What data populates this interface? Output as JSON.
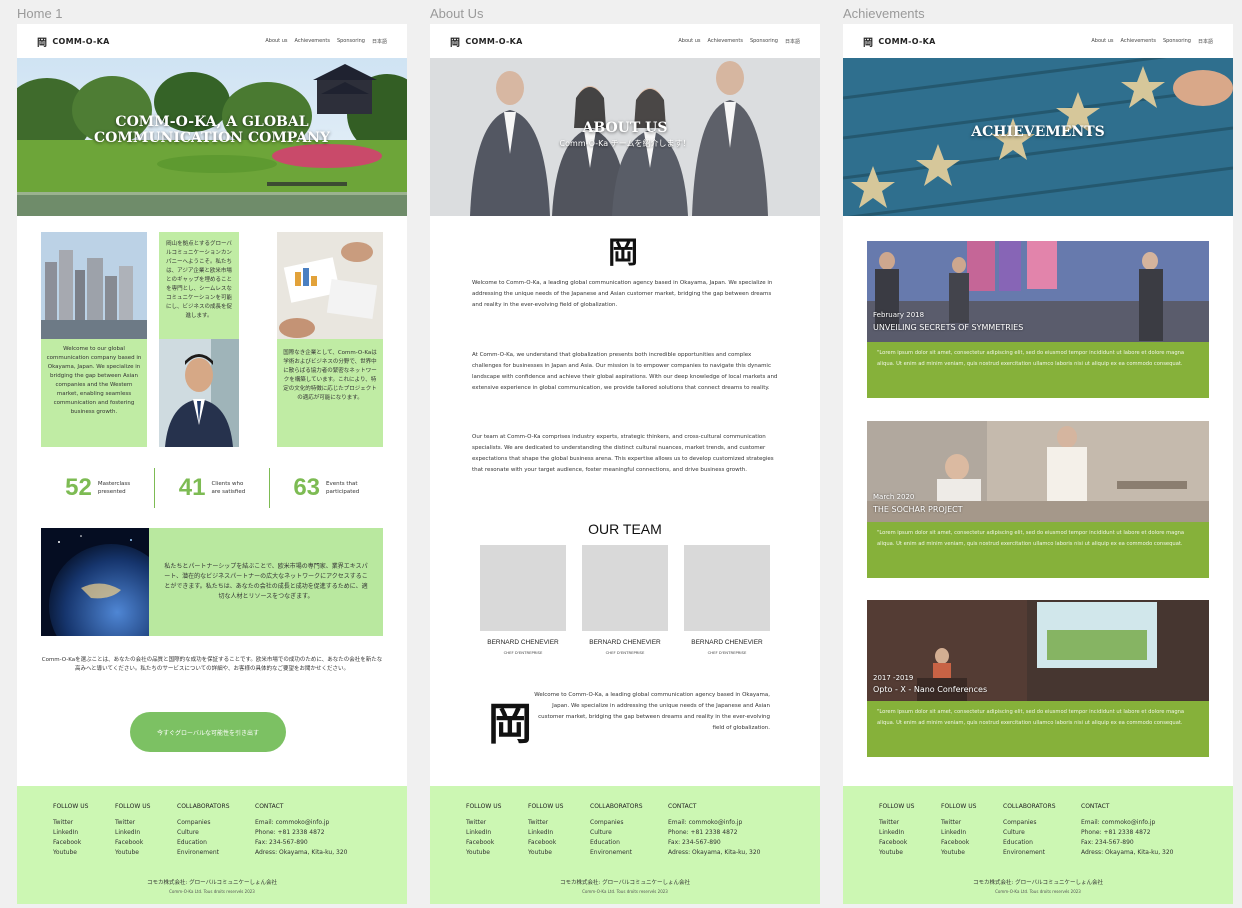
{
  "frames": [
    {
      "label": "Home 1"
    },
    {
      "label": "About Us"
    },
    {
      "label": "Achievements"
    }
  ],
  "header": {
    "logo_mark": "岡",
    "logo_text": "COMM-O-KA",
    "nav": [
      "About us",
      "Achievements",
      "Sponsoring",
      "日本語"
    ]
  },
  "home": {
    "hero_title_line1": "COMM-O-KA, A GLOBAL",
    "hero_title_line2": "COMMUNICATION COMPANY",
    "grid_text_jp1": "岡山を拠点とするグローバルコミュニケーションカンパニーへようこそ。私たちは、アジア企業と欧米市場とのギャップを埋めることを専門とし、シームレスなコミュニケーションを可能にし、ビジネスの成長を促進します。",
    "grid_text_en": "Welcome to our global communication company based in Okayama, Japan. We specialize in bridging the gap between Asian companies and the Western market, enabling seamless communication and fostering business growth.",
    "grid_text_jp2": "国際なき企業として、Comm-O-Kaは学術およびビジネスの分野で、世界中に散らばる協力者の緊密なネットワークを構築しています。これにより、特定の文化的特徴に応じたプロジェクトの適応が可能になります。",
    "stats": [
      {
        "num": "52",
        "label1": "Masterclass",
        "label2": "presented"
      },
      {
        "num": "41",
        "label1": "Clients who",
        "label2": "are satisfied"
      },
      {
        "num": "63",
        "label1": "Events that",
        "label2": "participated"
      }
    ],
    "globe_text": "私たちとパートナーシップを結ぶことで、欧米市場の専門家、業界エキスパート、潜在的なビジネスパートナーの広大なネットワークにアクセスすることができます。私たちは、あなたの会社の成長と成功を促進するために、適切な人材とリソースをつなぎます。",
    "choose_text": "Comm-O-Kaを選ぶことは、あなたの会社の品質と国際的な成功を保証することです。欧米市場での成功のために、あなたの会社を新たな高みへと導いてください。私たちのサービスについての詳細や、お客様の具体的なご要望をお聞かせください。",
    "cta": "今すぐグローバルな可能性を引き出す"
  },
  "about": {
    "hero_title": "ABOUT US",
    "hero_sub": "Comm-O-Ka チームを紹介します！",
    "kanji": "岡",
    "p1": "Welcome to Comm-O-Ka, a leading global communication agency based in Okayama, Japan. We specialize in addressing the unique needs of the Japanese and Asian customer market, bridging the gap between dreams and reality in the ever-evolving field of globalization.",
    "p2": "At Comm-O-Ka, we understand that globalization presents both incredible opportunities and complex challenges for businesses in Japan and Asia. Our mission is to empower companies to navigate this dynamic landscape with confidence and achieve their global aspirations. With our deep knowledge of local markets and extensive experience in global communication, we provide tailored solutions that connect dreams to reality.",
    "p3": "Our team at Comm-O-Ka comprises industry experts, strategic thinkers, and cross-cultural communication specialists. We are dedicated to understanding the distinct cultural nuances, market trends, and customer expectations that shape the global business arena. This expertise allows us to develop customized strategies that resonate with your target audience, foster meaningful connections, and drive business growth.",
    "team_title": "OUR TEAM",
    "team": [
      {
        "name": "BERNARD CHENEVIER",
        "role": "CHEF D'ENTREPRISE"
      },
      {
        "name": "BERNARD CHENEVIER",
        "role": "CHEF D'ENTREPRISE"
      },
      {
        "name": "BERNARD CHENEVIER",
        "role": "CHEF D'ENTREPRISE"
      }
    ],
    "p4": "Welcome to Comm-O-Ka, a leading global communication agency based in Okayama, Japan. We specialize in addressing the unique needs of the Japanese and Asian customer market, bridging the gap between dreams and reality in the ever-evolving field of globalization."
  },
  "achievements": {
    "hero_title": "ACHIEVEMENTS",
    "items": [
      {
        "date": "February 2018",
        "title": "UNVEILING SECRETS OF SYMMETRIES",
        "body": "\"Lorem ipsum dolor sit amet, consectetur adipiscing elit, sed do eiusmod tempor incididunt ut labore et dolore magna aliqua. Ut enim ad minim veniam, quis nostrud exercitation ullamco laboris nisi ut aliquip ex ea commodo consequat."
      },
      {
        "date": "March 2020",
        "title": "THE SOCHAR PROJECT",
        "body": "\"Lorem ipsum dolor sit amet, consectetur adipiscing elit, sed do eiusmod tempor incididunt ut labore et dolore magna aliqua. Ut enim ad minim veniam, quis nostrud exercitation ullamco laboris nisi ut aliquip ex ea commodo consequat."
      },
      {
        "date": "2017 -2019",
        "title": "Opto - X - Nano Conferences",
        "body": "\"Lorem ipsum dolor sit amet, consectetur adipiscing elit, sed do eiusmod tempor incididunt ut labore et dolore magna aliqua. Ut enim ad minim veniam, quis nostrud exercitation ullamco laboris nisi ut aliquip ex ea commodo consequat."
      }
    ]
  },
  "footer": {
    "columns": [
      {
        "heading": "FOLLOW US",
        "items": [
          "Twitter",
          "LinkedIn",
          "Facebook",
          "Youtube"
        ]
      },
      {
        "heading": "FOLLOW US",
        "items": [
          "Twitter",
          "LinkedIn",
          "Facebook",
          "Youtube"
        ]
      },
      {
        "heading": "COLLABORATORS",
        "items": [
          "Companies",
          "Culture",
          "Education",
          "Environement"
        ]
      },
      {
        "heading": "CONTACT",
        "items": [
          "Email: commoko@info.jp",
          "Phone: +81 2338 4872",
          "Fax: 234-567-890",
          "Adress: Okayama, Kita-ku, 320"
        ]
      }
    ],
    "copy_jp": "コモカ株式会社: グローバルコミュニケーしょん会社",
    "copy_en": "Comm-O-Ka Ltd. Tous droits reservés 2023"
  },
  "colors": {
    "accent_green": "#7dbb53",
    "footer_green": "#ccf7b3",
    "card_green": "#86b13a"
  }
}
